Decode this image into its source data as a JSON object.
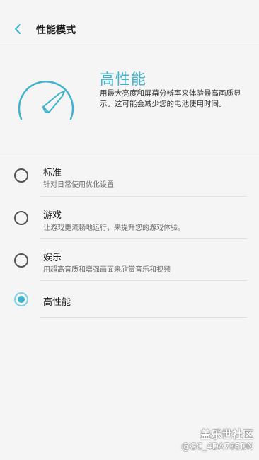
{
  "header": {
    "title": "性能模式"
  },
  "hero": {
    "title": "高性能",
    "description": "用最大亮度和屏幕分辨率来体验最高画质显示。这可能会减少您的电池使用时间。"
  },
  "options": [
    {
      "title": "标准",
      "subtitle": "针对日常使用优化设置",
      "selected": false
    },
    {
      "title": "游戏",
      "subtitle": "让游戏更流畅地运行，来提升您的游戏体验。",
      "selected": false
    },
    {
      "title": "娱乐",
      "subtitle": "用超高音质和增强画面来欣赏音乐和视频",
      "selected": false
    },
    {
      "title": "高性能",
      "subtitle": "",
      "selected": true
    }
  ],
  "watermark": {
    "logo": "盖乐世社区",
    "user": "@GC_4DA705DN"
  },
  "colors": {
    "accent": "#3fb3cd",
    "background": "#f5f5f5"
  }
}
